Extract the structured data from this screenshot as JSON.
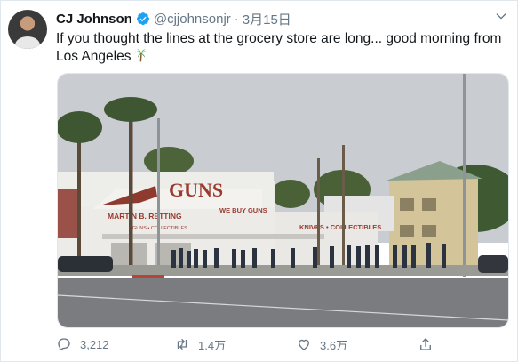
{
  "tweet": {
    "author": {
      "name": "CJ Johnson",
      "handle": "@cjjohnsonjr",
      "verified": true
    },
    "separator": "·",
    "date": "3月15日",
    "text": "If you thought the lines at the grocery store are long... good morning from Los Angeles",
    "emoji": "palm-tree",
    "photo": {
      "store_sign": "GUNS",
      "sign_line": "WE BUY GUNS",
      "sign_side": "MARTIN B. RETTING",
      "sign_knives": "KNIVES • COLLECTIBLES",
      "sign_small": "GUNS • COLLECTIBLES"
    },
    "actions": {
      "reply_count": "3,212",
      "retweet_count": "1.4万",
      "like_count": "3.6万"
    }
  },
  "colors": {
    "text_primary": "#14171a",
    "text_secondary": "#657786",
    "verified_blue": "#1da1f2",
    "border": "#e1e8ed"
  }
}
